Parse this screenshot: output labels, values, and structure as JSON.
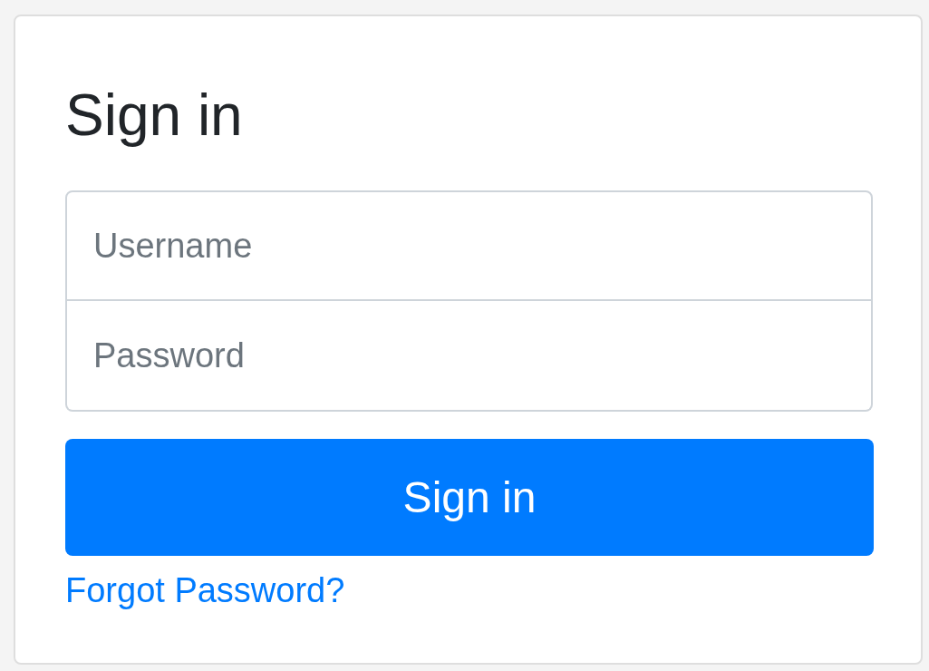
{
  "form": {
    "title": "Sign in",
    "fields": [
      {
        "placeholder": "Username"
      },
      {
        "placeholder": "Password"
      }
    ],
    "submit": "Sign in",
    "link": "Forgot Password?"
  }
}
